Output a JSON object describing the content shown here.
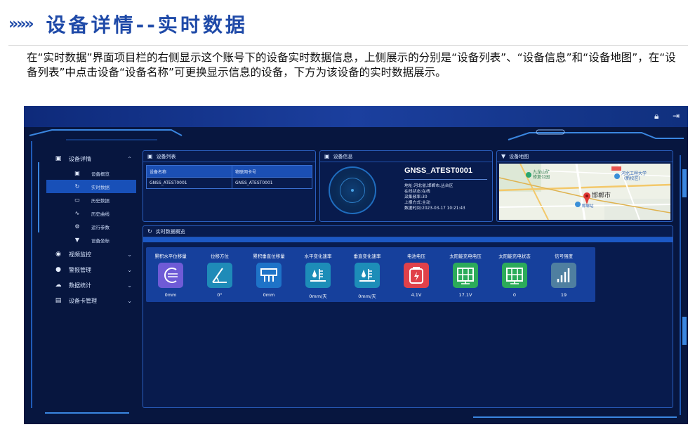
{
  "doc": {
    "arrows": "»»»",
    "title": "设备详情--实时数据",
    "description": "在“实时数据”界面项目栏的右侧显示这个账号下的设备实时数据信息，上侧展示的分别是“设备列表”、“设备信息”和“设备地图”，在“设备列表”中点击设备“设备名称”可更换显示信息的设备，下方为该设备的实时数据展示。"
  },
  "topbar": {
    "icons": [
      "lock-icon",
      "logout-icon"
    ]
  },
  "sidebar": {
    "group1": {
      "label": "设备详情",
      "icon": "device-icon"
    },
    "submenu": [
      {
        "label": "设备概览",
        "icon": "overview-icon"
      },
      {
        "label": "实时数据",
        "icon": "refresh-icon",
        "active": true
      },
      {
        "label": "历史数据",
        "icon": "history-icon"
      },
      {
        "label": "历史曲线",
        "icon": "curve-icon"
      },
      {
        "label": "运行参数",
        "icon": "settings-icon"
      },
      {
        "label": "设备坐标",
        "icon": "location-icon"
      }
    ],
    "groups": [
      {
        "label": "视频监控",
        "icon": "camera-icon"
      },
      {
        "label": "警报管理",
        "icon": "alert-icon"
      },
      {
        "label": "数据统计",
        "icon": "stats-icon"
      },
      {
        "label": "设备卡管理",
        "icon": "card-icon"
      }
    ]
  },
  "device_list": {
    "title": "设备列表",
    "columns": [
      "设备名称",
      "物联网卡号"
    ],
    "rows": [
      [
        "GNSS_ATEST0001",
        "GNSS_ATEST0001"
      ]
    ]
  },
  "device_info": {
    "title": "设备信息",
    "name": "GNSS_ATEST0001",
    "lines": [
      "地址:河北省,邯郸市,丛台区",
      "在线状态:在线",
      "采集频率:30",
      "上报方式:主动",
      "数据时间:2023-03-17 10:21:43"
    ]
  },
  "device_map": {
    "title": "设备地图",
    "labels": [
      "九龙山矿",
      "修复公园",
      "河北工程大学",
      "(新校区)",
      "邯郸市",
      "邯郸站"
    ]
  },
  "realtime": {
    "title": "实时数据概览",
    "metrics": [
      {
        "label": "累积水平位移量",
        "value": "0mm",
        "color": "#6f5bd6",
        "icon": "horizontal-displacement-icon"
      },
      {
        "label": "位移方位",
        "value": "0°",
        "color": "#1f8bb8",
        "icon": "angle-icon"
      },
      {
        "label": "累积垂直位移量",
        "value": "0mm",
        "color": "#1e73c8",
        "icon": "vertical-displacement-icon"
      },
      {
        "label": "水平变化速率",
        "value": "0mm/天",
        "color": "#1d8db8",
        "icon": "water-level-icon"
      },
      {
        "label": "垂直变化速率",
        "value": "0mm/天",
        "color": "#1d8db8",
        "icon": "water-level-icon"
      },
      {
        "label": "电池电压",
        "value": "4.1V",
        "color": "#e0414a",
        "icon": "battery-icon"
      },
      {
        "label": "太阳能充电电压",
        "value": "17.1V",
        "color": "#2cab5a",
        "icon": "solar-panel-icon"
      },
      {
        "label": "太阳能充电状态",
        "value": "0",
        "color": "#2cab5a",
        "icon": "solar-panel-icon"
      },
      {
        "label": "信号强度",
        "value": "19",
        "color": "#4f7fa0",
        "icon": "signal-icon"
      }
    ]
  }
}
